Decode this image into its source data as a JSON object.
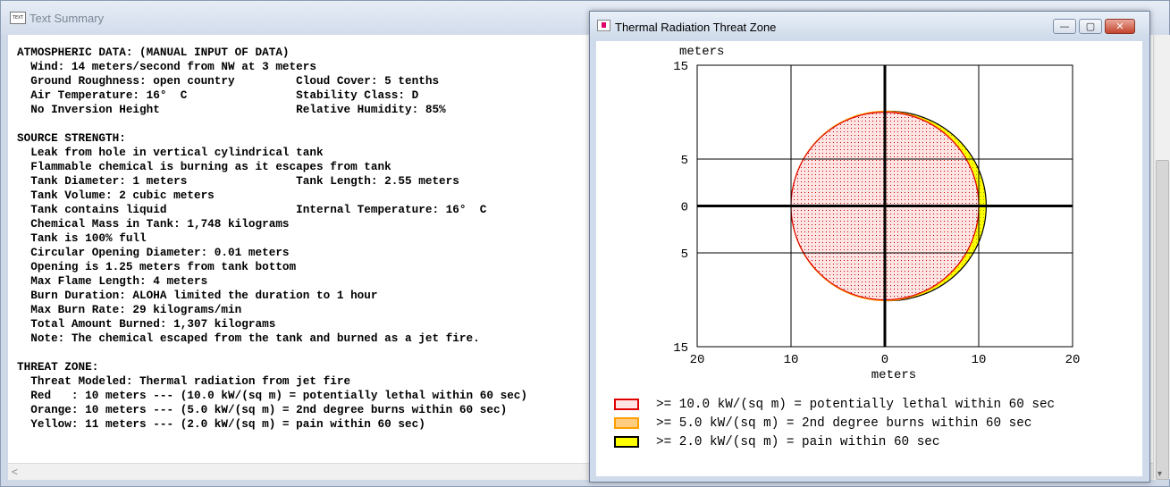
{
  "text_summary": {
    "title": "Text Summary",
    "icon_text": "TEXT",
    "lines": [
      "ATMOSPHERIC DATA: (MANUAL INPUT OF DATA)",
      "  Wind: 14 meters/second from NW at 3 meters",
      "  Ground Roughness: open country         Cloud Cover: 5 tenths",
      "  Air Temperature: 16°  C                Stability Class: D",
      "  No Inversion Height                    Relative Humidity: 85%",
      "",
      "SOURCE STRENGTH:",
      "  Leak from hole in vertical cylindrical tank",
      "  Flammable chemical is burning as it escapes from tank",
      "  Tank Diameter: 1 meters                Tank Length: 2.55 meters",
      "  Tank Volume: 2 cubic meters",
      "  Tank contains liquid                   Internal Temperature: 16°  C",
      "  Chemical Mass in Tank: 1,748 kilograms",
      "  Tank is 100% full",
      "  Circular Opening Diameter: 0.01 meters",
      "  Opening is 1.25 meters from tank bottom",
      "  Max Flame Length: 4 meters",
      "  Burn Duration: ALOHA limited the duration to 1 hour",
      "  Max Burn Rate: 29 kilograms/min",
      "  Total Amount Burned: 1,307 kilograms",
      "  Note: The chemical escaped from the tank and burned as a jet fire.",
      "",
      "THREAT ZONE:",
      "  Threat Modeled: Thermal radiation from jet fire",
      "  Red   : 10 meters --- (10.0 kW/(sq m) = potentially lethal within 60 sec)",
      "  Orange: 10 meters --- (5.0 kW/(sq m) = 2nd degree burns within 60 sec)",
      "  Yellow: 11 meters --- (2.0 kW/(sq m) = pain within 60 sec)"
    ]
  },
  "threat_window": {
    "title": "Thermal Radiation Threat Zone",
    "buttons": {
      "minimize": "—",
      "maximize": "▢",
      "close": "✕"
    }
  },
  "chart_data": {
    "type": "area",
    "y_axis_label": "meters",
    "x_axis_label": "meters",
    "xlim": [
      -20,
      20
    ],
    "ylim": [
      -15,
      15
    ],
    "x_tick_labels": [
      {
        "value": -20,
        "label": "20"
      },
      {
        "value": -10,
        "label": "10"
      },
      {
        "value": 0,
        "label": "0"
      },
      {
        "value": 10,
        "label": "10"
      },
      {
        "value": 20,
        "label": "20"
      }
    ],
    "y_tick_labels": [
      {
        "value": 15,
        "label": "15"
      },
      {
        "value": 5,
        "label": "5"
      },
      {
        "value": 0,
        "label": "0"
      },
      {
        "value": -5,
        "label": "5"
      },
      {
        "value": -15,
        "label": "15"
      }
    ],
    "grid": true,
    "zones": [
      {
        "name": "Red",
        "distance_m": 10,
        "x_min": -10,
        "x_max": 10,
        "y_half_width": 10,
        "fill": "#ffe4e4",
        "stroke": "#e00000",
        "dot": "#c00000"
      },
      {
        "name": "Orange",
        "distance_m": 10,
        "x_min": -10,
        "x_max": 10,
        "y_half_width": 10.1,
        "fill": "#ffe0b0",
        "stroke": "#ff9f00",
        "dot": "#cc7a00"
      },
      {
        "name": "Yellow",
        "distance_m": 11,
        "x_min": -10,
        "x_max": 10.8,
        "y_half_width": 10.1,
        "fill": "#ffff00",
        "stroke": "#000000",
        "dot": "#999900"
      }
    ],
    "legend": [
      {
        "label": ">= 10.0 kW/(sq m) = potentially lethal within 60 sec",
        "fill": "#ffe4e4",
        "border": "#e00000"
      },
      {
        "label": ">= 5.0 kW/(sq m) = 2nd degree burns within 60 sec",
        "fill": "#ffcc80",
        "border": "#ff9f00"
      },
      {
        "label": ">= 2.0 kW/(sq m) = pain within 60 sec",
        "fill": "#ffff00",
        "border": "#000000"
      }
    ]
  }
}
